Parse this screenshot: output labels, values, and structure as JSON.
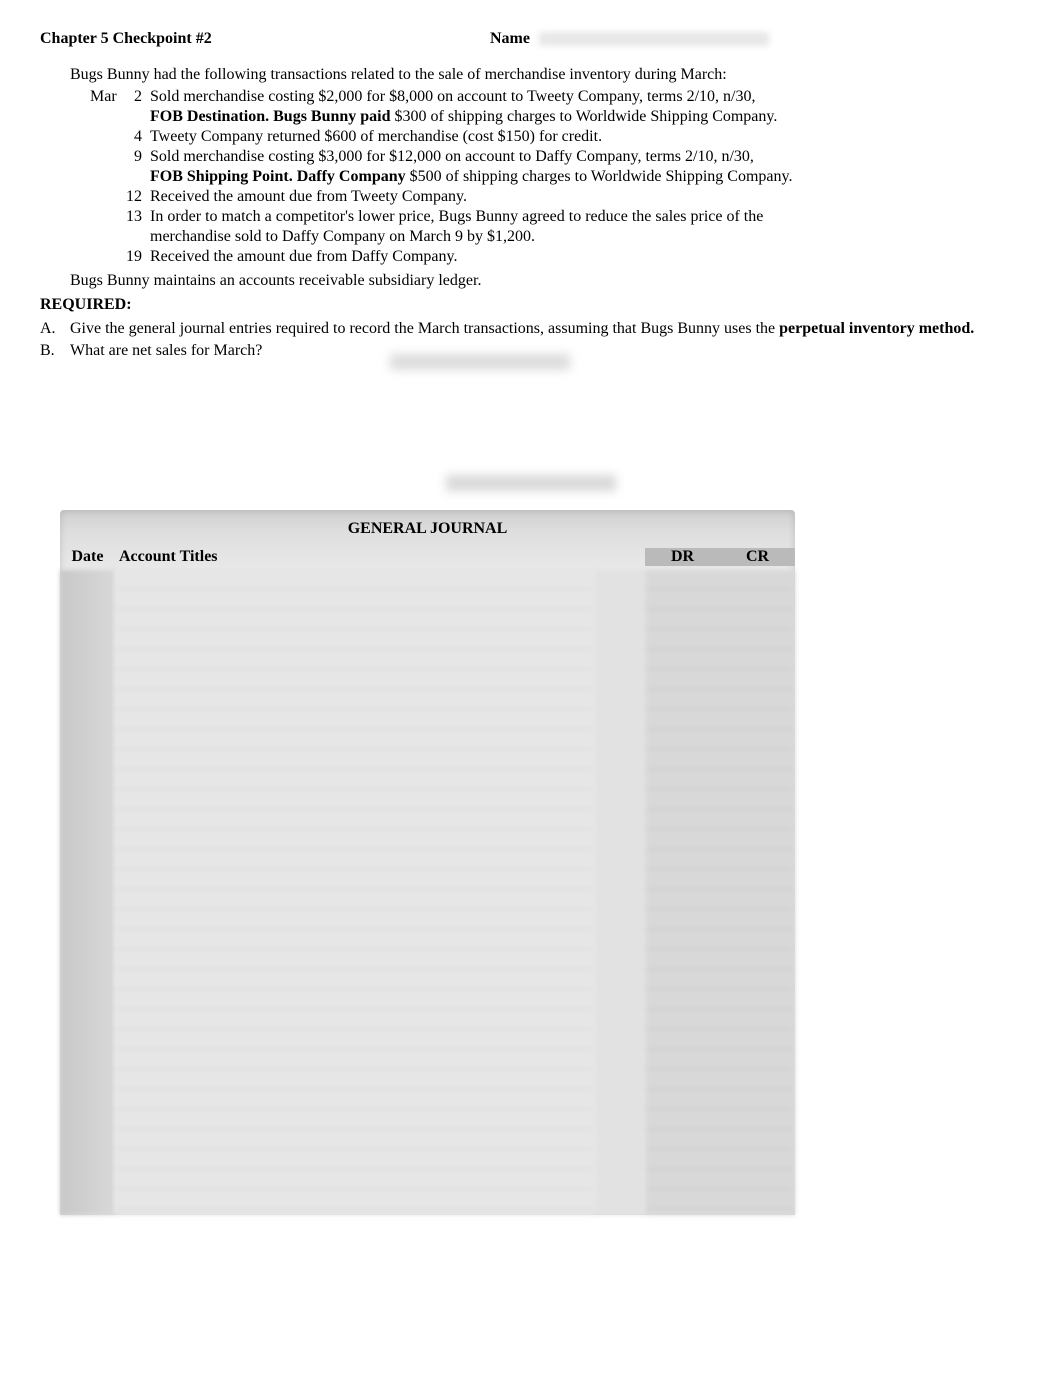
{
  "header": {
    "title": "Chapter 5 Checkpoint #2",
    "name_label": "Name"
  },
  "intro": "Bugs Bunny had the following transactions related to the sale of merchandise inventory during March:",
  "month": "Mar",
  "transactions": [
    {
      "show_month": true,
      "day": "2",
      "lines": [
        "Sold merchandise costing $2,000 for $8,000 on account to Tweety Company, terms 2/10, n/30,",
        "<b>FOB Destination.  Bugs Bunny paid</b> $300 of shipping charges to Worldwide Shipping Company."
      ]
    },
    {
      "show_month": false,
      "day": "4",
      "lines": [
        "Tweety Company returned $600 of merchandise (cost $150) for credit."
      ]
    },
    {
      "show_month": false,
      "day": "9",
      "lines": [
        "Sold merchandise costing $3,000 for $12,000 on account to Daffy Company, terms 2/10, n/30,",
        "<b>FOB Shipping Point.  Daffy Company</b> $500 of shipping charges to Worldwide Shipping Company."
      ]
    },
    {
      "show_month": false,
      "day": "12",
      "lines": [
        "Received the amount due from Tweety Company."
      ]
    },
    {
      "show_month": false,
      "day": "13",
      "lines": [
        "In order to match a competitor's lower price, Bugs Bunny agreed to reduce the sales price of the",
        "merchandise sold to Daffy Company on March 9 by $1,200."
      ]
    },
    {
      "show_month": false,
      "day": "19",
      "lines": [
        "Received the amount due from Daffy Company."
      ]
    }
  ],
  "subs_line": "Bugs Bunny maintains an accounts receivable subsidiary ledger.",
  "required_label": "REQUIRED:",
  "requirements": [
    {
      "letter": "A.",
      "html": "Give the general journal entries required to record the March transactions, assuming that Bugs Bunny uses the <b>perpetual inventory method.</b>"
    },
    {
      "letter": "B.",
      "html": "What are net sales for March?"
    }
  ],
  "journal": {
    "title": "GENERAL JOURNAL",
    "head_date": "Date",
    "head_account": "Account Titles",
    "head_dr": "DR",
    "head_cr": "CR"
  }
}
